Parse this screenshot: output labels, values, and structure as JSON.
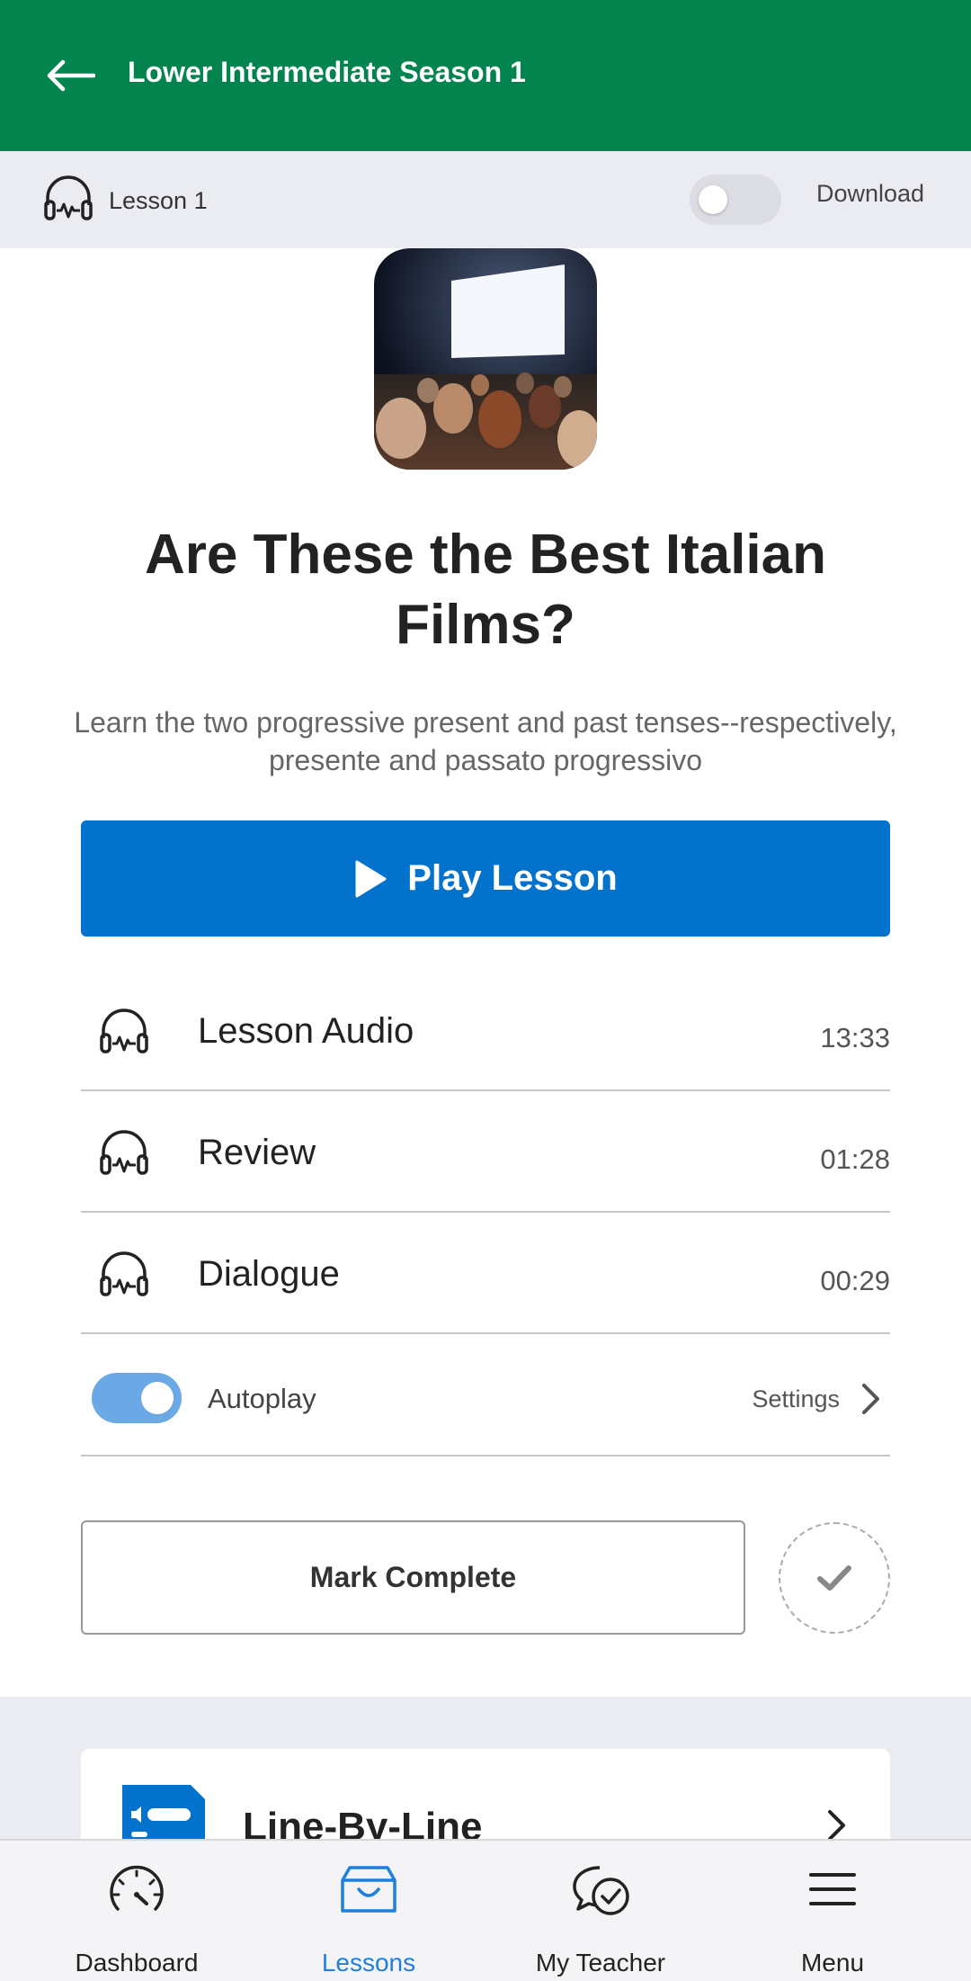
{
  "app_bar": {
    "title": "Lower Intermediate Season 1",
    "back_icon": "arrow-left-icon"
  },
  "subbar": {
    "lesson_label": "Lesson 1",
    "download_label": "Download",
    "download_enabled": false
  },
  "lesson": {
    "title": "Are These the Best Italian Films?",
    "description": "Learn the two progressive present and past tenses--respectively, presente and passato progressivo",
    "play_label": "Play Lesson"
  },
  "tracks": [
    {
      "name": "Lesson Audio",
      "duration": "13:33",
      "icon": "headphones-icon"
    },
    {
      "name": "Review",
      "duration": "01:28",
      "icon": "headphones-icon"
    },
    {
      "name": "Dialogue",
      "duration": "00:29",
      "icon": "headphones-icon"
    }
  ],
  "autoplay": {
    "label": "Autoplay",
    "enabled": true,
    "settings_label": "Settings"
  },
  "mark_complete": {
    "label": "Mark Complete"
  },
  "card": {
    "title": "Line-By-Line"
  },
  "bottom_nav": [
    {
      "label": "Dashboard",
      "icon": "speedometer-icon",
      "active": false
    },
    {
      "label": "Lessons",
      "icon": "inbox-icon",
      "active": true
    },
    {
      "label": "My Teacher",
      "icon": "chat-check-icon",
      "active": false
    },
    {
      "label": "Menu",
      "icon": "hamburger-icon",
      "active": false
    }
  ],
  "colors": {
    "header": "#03844f",
    "primary": "#0272cc",
    "toggle_on": "#6ba9e6",
    "nav_active": "#1f7fdc"
  }
}
